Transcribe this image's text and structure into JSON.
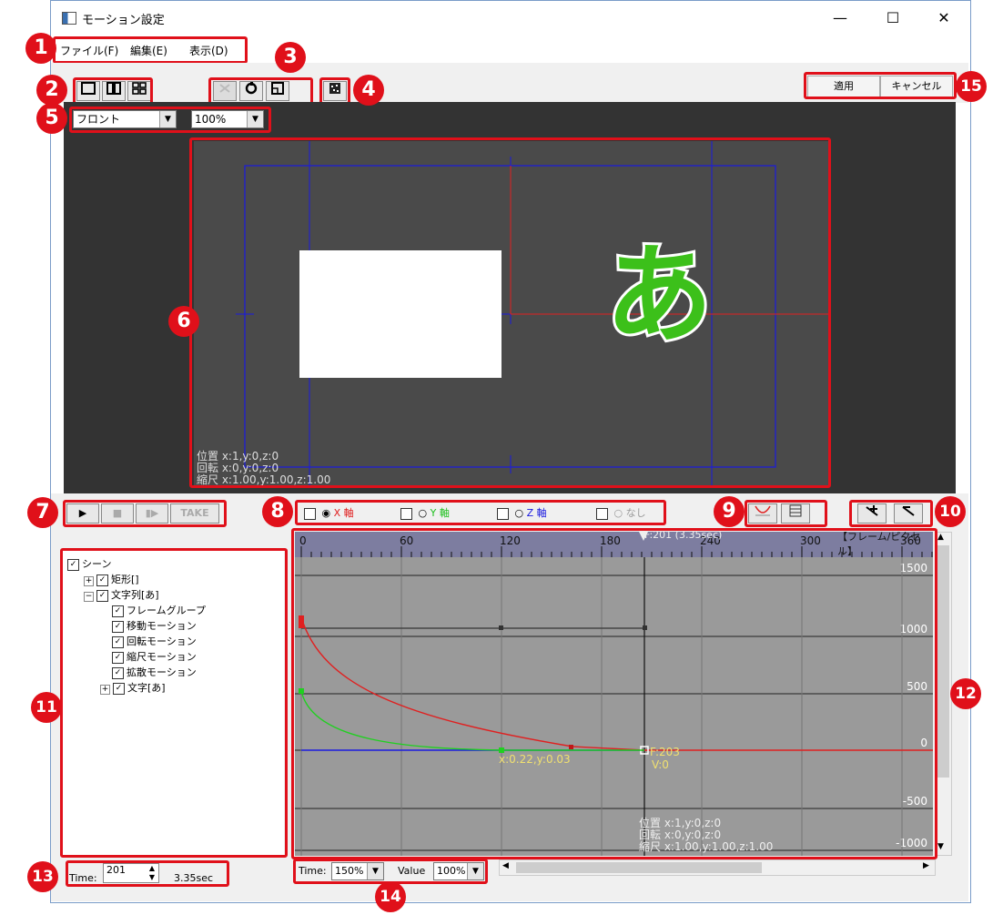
{
  "window": {
    "title": "モーション設定",
    "minimize": "—",
    "maximize": "☐",
    "close": "✕"
  },
  "menu": {
    "items": [
      {
        "label": "ファイル(F)"
      },
      {
        "label": "編集(E)"
      },
      {
        "label": "表示(D)"
      }
    ]
  },
  "toolbar": {
    "apply_label": "適用",
    "cancel_label": "キャンセル"
  },
  "view": {
    "view_select": "フロント",
    "zoom_select": "100%"
  },
  "preview": {
    "char": "あ",
    "info_lines": [
      "位置 x:1,y:0,z:0",
      "回転 x:0,y:0,z:0",
      "縮尺 x:1.00,y:1.00,z:1.00"
    ]
  },
  "playback": {
    "play": "▶",
    "stop": "■",
    "step": "▮▶",
    "take": "TAKE"
  },
  "axes": {
    "x_label": "X 軸",
    "y_label": "Y 軸",
    "z_label": "Z 軸",
    "none_label": "なし"
  },
  "tree": {
    "items": [
      {
        "label": "シーン",
        "indent": 0,
        "expander": ""
      },
      {
        "label": "矩形[]",
        "indent": 1,
        "expander": "+"
      },
      {
        "label": "文字列[あ]",
        "indent": 1,
        "expander": "−"
      },
      {
        "label": "フレームグループ",
        "indent": 2,
        "expander": ""
      },
      {
        "label": "移動モーション",
        "indent": 2,
        "expander": ""
      },
      {
        "label": "回転モーション",
        "indent": 2,
        "expander": ""
      },
      {
        "label": "縮尺モーション",
        "indent": 2,
        "expander": ""
      },
      {
        "label": "拡散モーション",
        "indent": 2,
        "expander": ""
      },
      {
        "label": "文字[あ]",
        "indent": 2,
        "expander": "+"
      }
    ]
  },
  "graph": {
    "ruler_ticks": [
      "0",
      "60",
      "120",
      "180",
      "240",
      "300",
      "360"
    ],
    "ruler_marker": "F:201 (3.35sec)",
    "ruler_unit": "【フレーム/ピクセル】",
    "value_ticks": [
      "1500",
      "1000",
      "500",
      "0",
      "-500",
      "-1000"
    ],
    "point_label": "x:0.22,y:0.03",
    "frame_label": "F:203",
    "value_label": "V:0",
    "info_lines": [
      "位置 x:1,y:0,z:0",
      "回転 x:0,y:0,z:0",
      "縮尺 x:1.00,y:1.00,z:1.00"
    ]
  },
  "time": {
    "label": "Time:",
    "frame": "201",
    "seconds": "3.35sec"
  },
  "scale": {
    "time_label": "Time:",
    "time_value": "150%",
    "value_label": "Value",
    "value_value": "100%"
  },
  "badges": [
    "1",
    "2",
    "3",
    "4",
    "5",
    "6",
    "7",
    "8",
    "9",
    "10",
    "11",
    "12",
    "13",
    "14",
    "15"
  ],
  "colors": {
    "annotation_red": "#e0101a",
    "glyph_green": "#3cc01a",
    "guide_blue": "#1a1ae0",
    "curve_red": "#e02020",
    "curve_green": "#20d020"
  }
}
